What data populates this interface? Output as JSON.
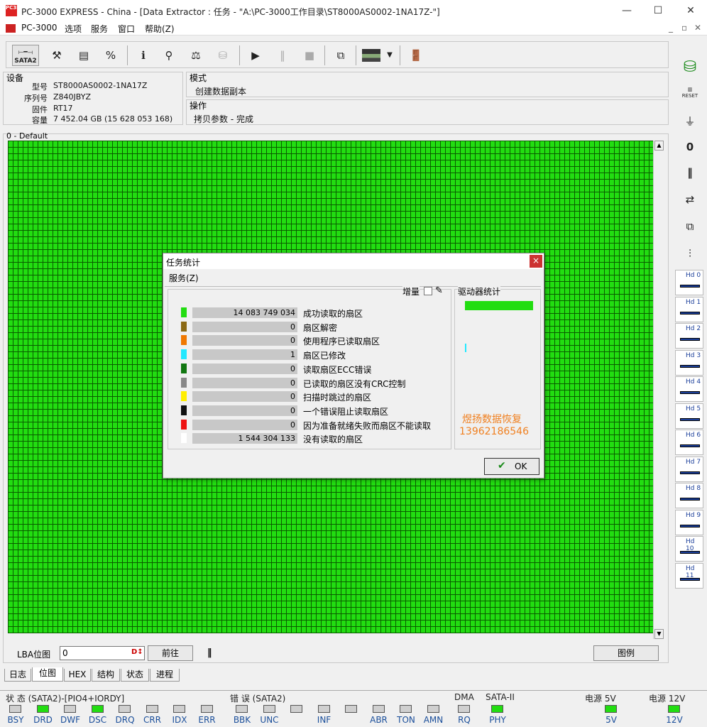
{
  "window": {
    "title": "PC-3000 EXPRESS - China - [Data Extractor : 任务 - \"A:\\PC-3000工作目录\\ST8000AS0002-1NA17Z-\"]",
    "icon_text": "PC3K",
    "min": "—",
    "max": "☐",
    "close": "✕"
  },
  "menu": {
    "items": [
      "PC-3000",
      "选项",
      "服务",
      "窗口",
      "帮助(Z)"
    ],
    "mdi": [
      "_",
      "▫",
      "✕"
    ]
  },
  "toolbar": {
    "sata_label": "SATA2",
    "buttons": [
      "sata-icon",
      "tools-icon",
      "drive-id-icon",
      "percent-icon",
      "info-icon",
      "binoculars-icon",
      "scale-icon",
      "disk-icon",
      "play-icon",
      "pause-icon",
      "stop-icon",
      "copy-icon",
      "image-icon",
      "dropdown-icon",
      "exit-icon"
    ]
  },
  "device": {
    "caption": "设备",
    "fields": [
      {
        "label": "型号",
        "value": "ST8000AS0002-1NA17Z"
      },
      {
        "label": "序列号",
        "value": "Z840JBYZ"
      },
      {
        "label": "固件",
        "value": "RT17"
      },
      {
        "label": "容量",
        "value": "7 452.04 GB (15 628 053 168)"
      }
    ]
  },
  "mode": {
    "caption": "模式",
    "value": "创建数据副本"
  },
  "operation": {
    "caption": "操作",
    "value": "拷贝参数 - 完成"
  },
  "map": {
    "caption": "0 - Default"
  },
  "lba": {
    "label": "LBA位图",
    "value": "0",
    "go": "前往",
    "pause": "‖",
    "legend": "图例"
  },
  "tabs": [
    "日志",
    "位图",
    "HEX",
    "结构",
    "状态",
    "进程"
  ],
  "status": {
    "group1_caption": "状 态 (SATA2)-[PIO4+IORDY]",
    "group1": [
      {
        "l": "BSY",
        "on": false
      },
      {
        "l": "DRD",
        "on": true
      },
      {
        "l": "DWF",
        "on": false
      },
      {
        "l": "DSC",
        "on": true
      },
      {
        "l": "DRQ",
        "on": false
      },
      {
        "l": "CRR",
        "on": false
      },
      {
        "l": "IDX",
        "on": false
      },
      {
        "l": "ERR",
        "on": false
      }
    ],
    "group2_caption": "错 误 (SATA2)",
    "group2": [
      {
        "l": "BBK",
        "on": false
      },
      {
        "l": "UNC",
        "on": false
      },
      {
        "l": "",
        "on": false
      },
      {
        "l": "INF",
        "on": false
      },
      {
        "l": "",
        "on": false
      },
      {
        "l": "ABR",
        "on": false
      },
      {
        "l": "TON",
        "on": false
      },
      {
        "l": "AMN",
        "on": false
      }
    ],
    "dma_caption": "DMA",
    "dma": {
      "l": "RQ",
      "on": false
    },
    "sata_caption": "SATA-II",
    "sata": {
      "l": "PHY",
      "on": true
    },
    "p5_caption": "电源 5V",
    "p5": {
      "l": "5V",
      "on": true
    },
    "p12_caption": "电源 12V",
    "p12": {
      "l": "12V",
      "on": true
    }
  },
  "sidebar": {
    "reset": "RESET",
    "hds": [
      "Hd 0",
      "Hd 1",
      "Hd 2",
      "Hd 3",
      "Hd 4",
      "Hd 5",
      "Hd 6",
      "Hd 7",
      "Hd 8",
      "Hd 9",
      "Hd 10",
      "Hd 11"
    ]
  },
  "dialog": {
    "title": "任务统计",
    "close": "×",
    "menu": "服务(Z)",
    "increment": "增量",
    "drive_stats": "驱动器统计",
    "rows": [
      {
        "color": "#22dd11",
        "value": "14 083 749 034",
        "label": "成功读取的扇区"
      },
      {
        "color": "#8b6914",
        "value": "0",
        "label": "扇区解密"
      },
      {
        "color": "#f07800",
        "value": "0",
        "label": "使用程序已读取扇区"
      },
      {
        "color": "#22e8ff",
        "value": "1",
        "label": "扇区已修改"
      },
      {
        "color": "#117711",
        "value": "0",
        "label": "读取扇区ECC错误"
      },
      {
        "color": "#888888",
        "value": "0",
        "label": "已读取的扇区没有CRC控制"
      },
      {
        "color": "#ffee00",
        "value": "0",
        "label": "扫描时跳过的扇区"
      },
      {
        "color": "#111111",
        "value": "0",
        "label": "一个错误阻止读取扇区"
      },
      {
        "color": "#ee1111",
        "value": "0",
        "label": "因为准备就绪失败而扇区不能读取"
      },
      {
        "color": "#ffffff",
        "value": "1 544 304 133",
        "label": "没有读取的扇区"
      }
    ],
    "watermark1": "煜扬数据恢复",
    "watermark2": "13962186546",
    "ok": "OK"
  }
}
